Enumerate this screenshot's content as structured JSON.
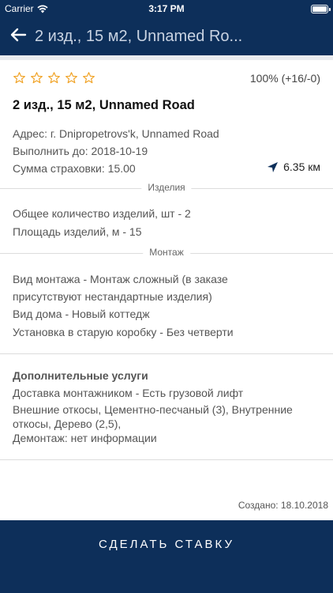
{
  "status_bar": {
    "carrier": "Carrier",
    "time": "3:17 PM"
  },
  "header": {
    "title": "2 изд., 15 м2, Unnamed Ro..."
  },
  "order": {
    "rating_stars": 5,
    "rating_filled": 0,
    "rating_text": "100% (+16/-0)",
    "title": "2 изд., 15 м2, Unnamed Road",
    "address": "Адрес: г. Dnipropetrovs'k, Unnamed Road",
    "deadline": "Выполнить до: 2018-10-19",
    "insurance": "Сумма страховки: 15.00",
    "distance": "6.35 км"
  },
  "products": {
    "label": "Изделия",
    "lines": [
      "Общее количество изделий, шт - 2",
      "Площадь изделий, м - 15"
    ]
  },
  "mounting": {
    "label": "Монтаж",
    "lines": [
      "Вид монтажа - Монтаж сложный (в заказе",
      "присутствуют нестандартные изделия)",
      "Вид дома - Новый коттедж",
      "Установка в старую коробку - Без четверти"
    ]
  },
  "extra": {
    "title": "Дополнительные услуги",
    "lines": [
      "Доставка монтажником - Есть грузовой лифт",
      "Внешние откосы, Цементно-песчаный (3), Внутренние",
      "откосы, Дерево (2,5),",
      "Демонтаж: нет информации"
    ]
  },
  "created": "Создано: 18.10.2018",
  "action": {
    "label": "СДЕЛАТЬ СТАВКУ"
  },
  "colors": {
    "brand": "#0d2f5a",
    "star": "#f0a020"
  }
}
